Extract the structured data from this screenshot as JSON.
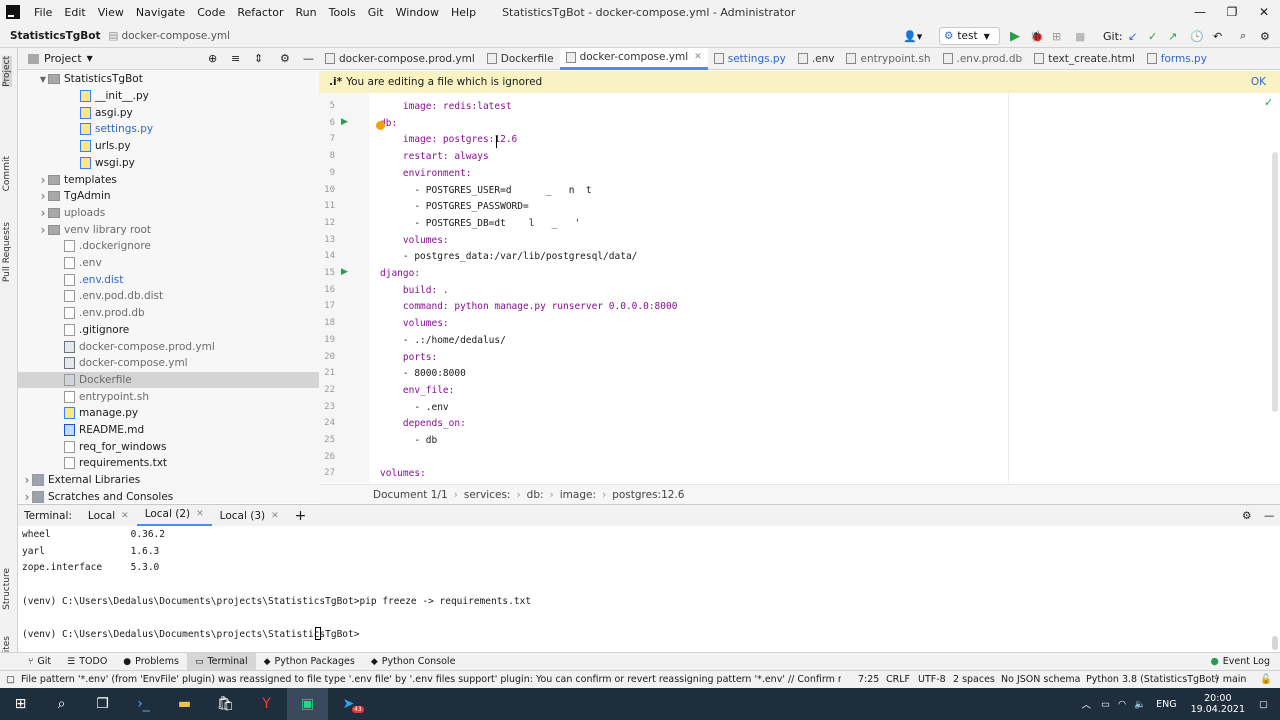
{
  "window": {
    "title": "StatisticsTgBot - docker-compose.yml - Administrator",
    "menu": [
      "File",
      "Edit",
      "View",
      "Navigate",
      "Code",
      "Refactor",
      "Run",
      "Tools",
      "Git",
      "Window",
      "Help"
    ]
  },
  "navbar": {
    "project": "StatisticsTgBot",
    "file": "docker-compose.yml",
    "run_config": "test",
    "git_label": "Git:"
  },
  "sidebar_left": {
    "labels": [
      "Project",
      "Commit",
      "Pull Requests"
    ],
    "bottom_labels": [
      "Structure",
      "Favorites"
    ]
  },
  "project_panel": {
    "title": "Project",
    "tree": [
      {
        "label": "StatisticsTgBot",
        "indent": 2,
        "type": "dir",
        "expanded": true
      },
      {
        "label": "__init__.py",
        "indent": 3,
        "type": "py"
      },
      {
        "label": "asgi.py",
        "indent": 3,
        "type": "py"
      },
      {
        "label": "settings.py",
        "indent": 3,
        "type": "py",
        "color": "#2f65ca"
      },
      {
        "label": "urls.py",
        "indent": 3,
        "type": "py"
      },
      {
        "label": "wsgi.py",
        "indent": 3,
        "type": "py"
      },
      {
        "label": "templates",
        "indent": 1,
        "type": "dir",
        "collapsed": true
      },
      {
        "label": "TgAdmin",
        "indent": 1,
        "type": "dir",
        "collapsed": true
      },
      {
        "label": "uploads",
        "indent": 1,
        "type": "dir",
        "collapsed": true,
        "color": "#6b6b6b"
      },
      {
        "label": "venv  library root",
        "indent": 1,
        "type": "dir",
        "collapsed": true,
        "color": "#6b6b6b"
      },
      {
        "label": ".dockerignore",
        "indent": 2,
        "type": "file",
        "color": "#6b6b6b"
      },
      {
        "label": ".env",
        "indent": 2,
        "type": "file",
        "color": "#6b6b6b"
      },
      {
        "label": ".env.dist",
        "indent": 2,
        "type": "file",
        "color": "#2f65ca"
      },
      {
        "label": ".env.pod.db.dist",
        "indent": 2,
        "type": "file",
        "color": "#6b6b6b"
      },
      {
        "label": ".env.prod.db",
        "indent": 2,
        "type": "file",
        "color": "#6b6b6b"
      },
      {
        "label": ".gitignore",
        "indent": 2,
        "type": "file"
      },
      {
        "label": "docker-compose.prod.yml",
        "indent": 2,
        "type": "yml",
        "color": "#6b6b6b"
      },
      {
        "label": "docker-compose.yml",
        "indent": 2,
        "type": "yml",
        "color": "#6b6b6b"
      },
      {
        "label": "Dockerfile",
        "indent": 2,
        "type": "dc",
        "color": "#6b6b6b",
        "selected": true
      },
      {
        "label": "entrypoint.sh",
        "indent": 2,
        "type": "file",
        "color": "#6b6b6b"
      },
      {
        "label": "manage.py",
        "indent": 2,
        "type": "py"
      },
      {
        "label": "README.md",
        "indent": 2,
        "type": "md"
      },
      {
        "label": "req_for_windows",
        "indent": 2,
        "type": "file"
      },
      {
        "label": "requirements.txt",
        "indent": 2,
        "type": "file"
      },
      {
        "label": "External Libraries",
        "indent": 0,
        "type": "lib",
        "collapsed": true
      },
      {
        "label": "Scratches and Consoles",
        "indent": 0,
        "type": "lib",
        "collapsed": true
      }
    ]
  },
  "editor_tabs": [
    {
      "label": "docker-compose.prod.yml",
      "color": "#333"
    },
    {
      "label": "Dockerfile",
      "color": "#333"
    },
    {
      "label": "docker-compose.yml",
      "color": "#333",
      "active": true
    },
    {
      "label": "settings.py",
      "color": "#2f65ca"
    },
    {
      "label": ".env",
      "color": "#333"
    },
    {
      "label": "entrypoint.sh",
      "color": "#666"
    },
    {
      "label": ".env.prod.db",
      "color": "#666"
    },
    {
      "label": "text_create.html",
      "color": "#333"
    },
    {
      "label": "forms.py",
      "color": "#2f65ca"
    }
  ],
  "banner": {
    "text": "You are editing a file which is ignored",
    "ok": "OK"
  },
  "code_lines": [
    {
      "n": "5",
      "text": "    image: redis:latest",
      "indent": 2
    },
    {
      "n": "6",
      "text": "db:",
      "indent": 1,
      "run": true
    },
    {
      "n": "7",
      "text": "    image: postgres:12.6",
      "indent": 2
    },
    {
      "n": "8",
      "text": "    restart: always",
      "indent": 2
    },
    {
      "n": "9",
      "text": "    environment:",
      "indent": 2
    },
    {
      "n": "10",
      "text": "      - POSTGRES_USER=d      _   n  t",
      "indent": 3
    },
    {
      "n": "11",
      "text": "      - POSTGRES_PASSWORD=",
      "indent": 3
    },
    {
      "n": "12",
      "text": "      - POSTGRES_DB=dt    l   _   '",
      "indent": 3
    },
    {
      "n": "13",
      "text": "    volumes:",
      "indent": 2
    },
    {
      "n": "14",
      "text": "    - postgres_data:/var/lib/postgresql/data/",
      "indent": 2
    },
    {
      "n": "15",
      "text": "django:",
      "indent": 1,
      "run": true
    },
    {
      "n": "16",
      "text": "    build: .",
      "indent": 2
    },
    {
      "n": "17",
      "text": "    command: python manage.py runserver 0.0.0.0:8000",
      "indent": 2
    },
    {
      "n": "18",
      "text": "    volumes:",
      "indent": 2
    },
    {
      "n": "19",
      "text": "    - .:/home/dedalus/",
      "indent": 2
    },
    {
      "n": "20",
      "text": "    ports:",
      "indent": 2
    },
    {
      "n": "21",
      "text": "    - 8000:8000",
      "indent": 2
    },
    {
      "n": "22",
      "text": "    env_file:",
      "indent": 2
    },
    {
      "n": "23",
      "text": "      - .env",
      "indent": 3
    },
    {
      "n": "24",
      "text": "    depends_on:",
      "indent": 2
    },
    {
      "n": "25",
      "text": "      - db",
      "indent": 3
    },
    {
      "n": "26",
      "text": "",
      "indent": 0
    },
    {
      "n": "27",
      "text": "volumes:",
      "indent": 0
    }
  ],
  "breadcrumb": [
    "Document 1/1",
    "services:",
    "db:",
    "image:",
    "postgres:12.6"
  ],
  "terminal": {
    "label": "Terminal:",
    "tabs": [
      "Local",
      "Local (2)",
      "Local (3)"
    ],
    "active_tab": 1,
    "lines": [
      "wheel              0.36.2",
      "yarl               1.6.3",
      "zope.interface     5.3.0",
      "",
      "(venv) C:\\Users\\Dedalus\\Documents\\projects\\StatisticsTgBot>pip freeze -> requirements.txt",
      "",
      "(venv) C:\\Users\\Dedalus\\Documents\\projects\\StatisticsTgBot>"
    ]
  },
  "tool_windows": [
    "Git",
    "TODO",
    "Problems",
    "Terminal",
    "Python Packages",
    "Python Console"
  ],
  "event_log": "Event Log",
  "status": {
    "message": "File pattern '*.env' (from 'EnvFile' plugin) was reassigned to file type '.env file' by '.env files support' plugin: You can confirm or revert reassigning pattern '*.env' // Confirm r... (37 minutes",
    "position": "7:25",
    "line_sep": "CRLF",
    "encoding": "UTF-8",
    "indent": "2 spaces",
    "schema": "No JSON schema",
    "interpreter": "Python 3.8 (StatisticsTgBot)",
    "branch": "main"
  },
  "taskbar": {
    "lang": "ENG",
    "time": "20:00",
    "date": "19.04.2021",
    "telegram_badge": "43"
  }
}
